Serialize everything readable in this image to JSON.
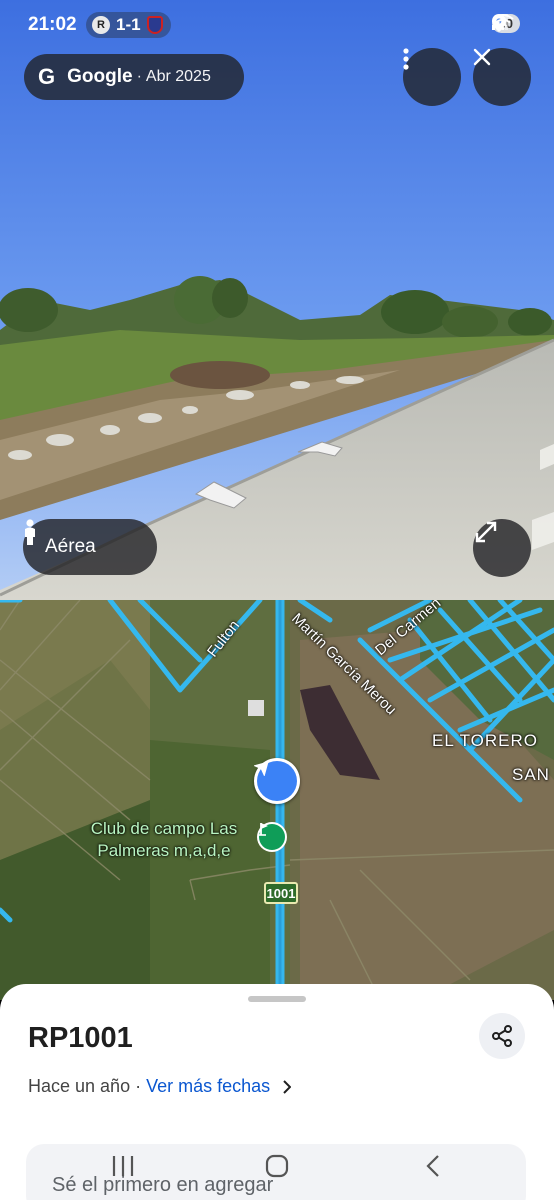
{
  "status_bar": {
    "time": "21:02",
    "match_badge": "R",
    "score": "1-1",
    "battery": "40"
  },
  "header": {
    "brand": "Google",
    "separator": "·",
    "capture_date": "Abr 2025",
    "menu_icon": "more-vert-icon",
    "close_icon": "close-icon"
  },
  "street_view": {
    "view_toggle_label": "Aérea",
    "view_toggle_icon": "pegman-icon",
    "expand_icon": "fullscreen-icon"
  },
  "map": {
    "streets": [
      "Fulton",
      "Martín García Merou",
      "Del Carmen"
    ],
    "area_labels": [
      "EL TORERO",
      "SAN"
    ],
    "poi_name": "Club de campo Las Palmeras m,a,d,e",
    "route_shield": "1001",
    "colors": {
      "street_highlight": "#35b8ee",
      "poi_text": "#b9f5c2",
      "location_marker": "#3b82f6"
    }
  },
  "sheet": {
    "title": "RP1001",
    "time_ago": "Hace un año",
    "separator": "·",
    "more_dates_link": "Ver más fechas",
    "contribution_prompt": "Sé el primero en agregar",
    "share_icon": "share-icon"
  },
  "nav": {
    "recents_icon": "recents-icon",
    "home_icon": "home-icon",
    "back_icon": "back-icon"
  }
}
